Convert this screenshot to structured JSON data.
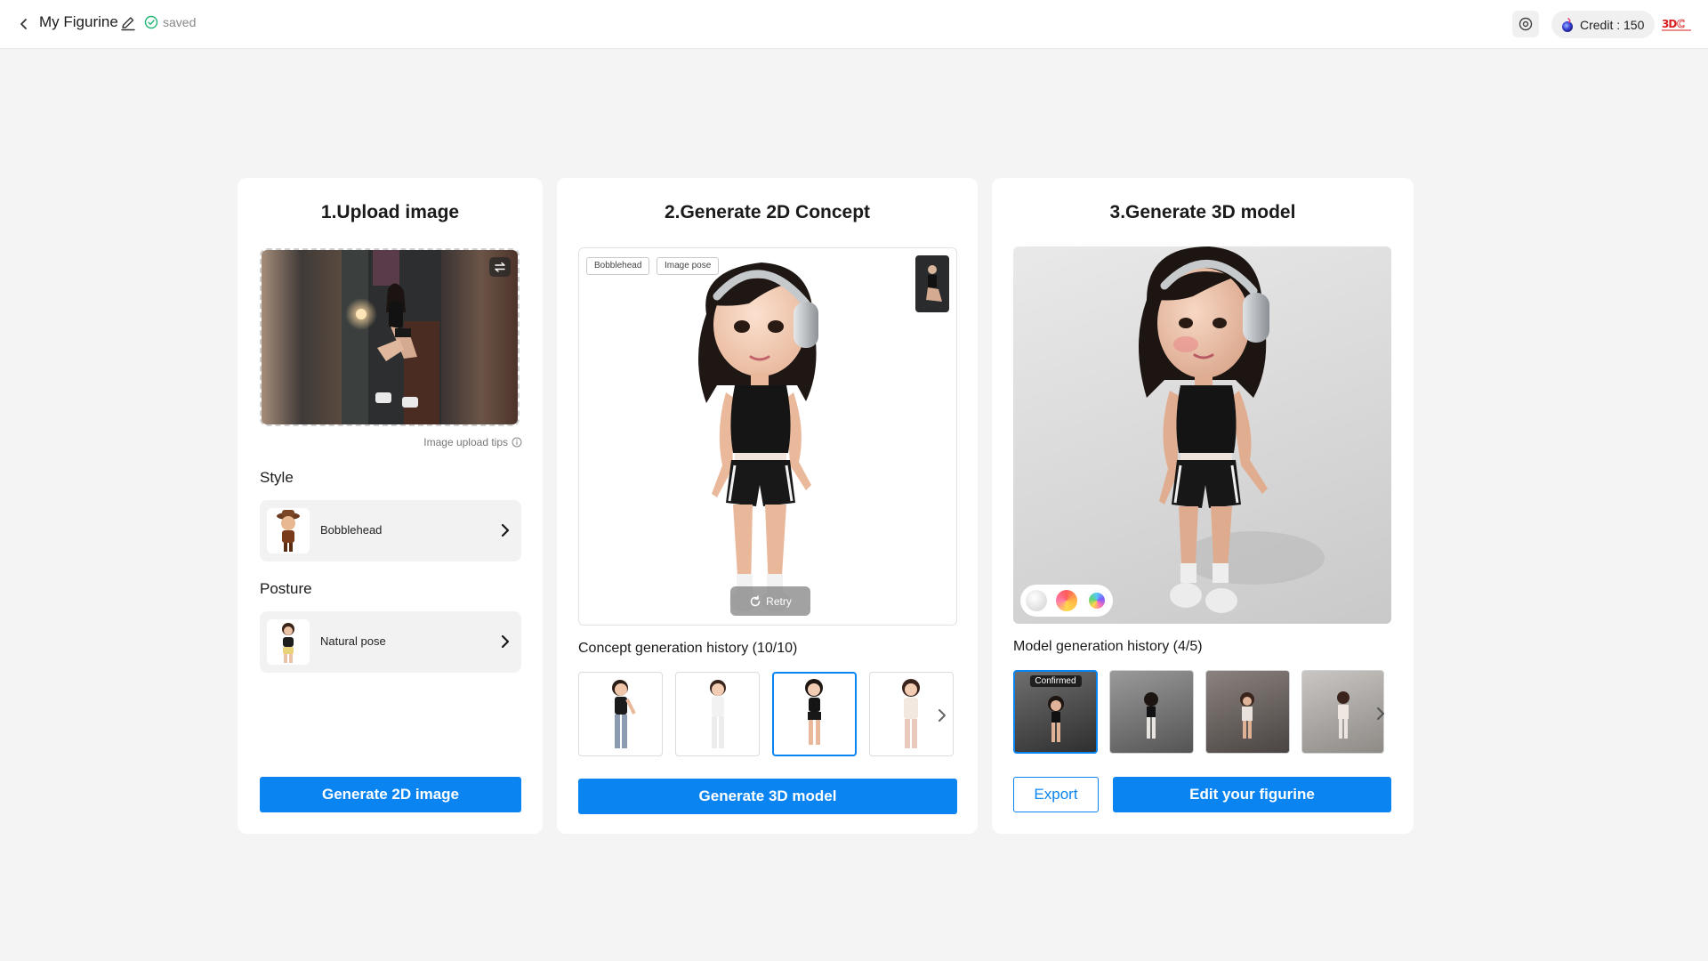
{
  "header": {
    "back_icon": "chevron-left-icon",
    "project_name": "My Figurine",
    "edit_icon": "pencil-icon",
    "saved_status": "saved",
    "settings_icon": "settings-icon",
    "credit_label": "Credit : 150",
    "logo_text": "3DC"
  },
  "upload_card": {
    "title": "1.Upload image",
    "tips_label": "Image upload tips",
    "style_label": "Style",
    "style_value": "Bobblehead",
    "posture_label": "Posture",
    "posture_value": "Natural pose",
    "generate_button": "Generate 2D image"
  },
  "concept_card": {
    "title": "2.Generate 2D Concept",
    "tags": [
      "Bobblehead",
      "Image pose"
    ],
    "retry_label": "Retry",
    "history_label": "Concept generation history (10/10)",
    "history_selected_index": 2,
    "generate_button": "Generate 3D model"
  },
  "model_card": {
    "title": "3.Generate 3D model",
    "history_label": "Model generation history (4/5)",
    "confirmed_badge": "Confirmed",
    "export_button": "Export",
    "edit_button": "Edit your figurine"
  },
  "colors": {
    "accent": "#0a84f0",
    "background": "#f4f4f5",
    "success": "#22b573"
  }
}
